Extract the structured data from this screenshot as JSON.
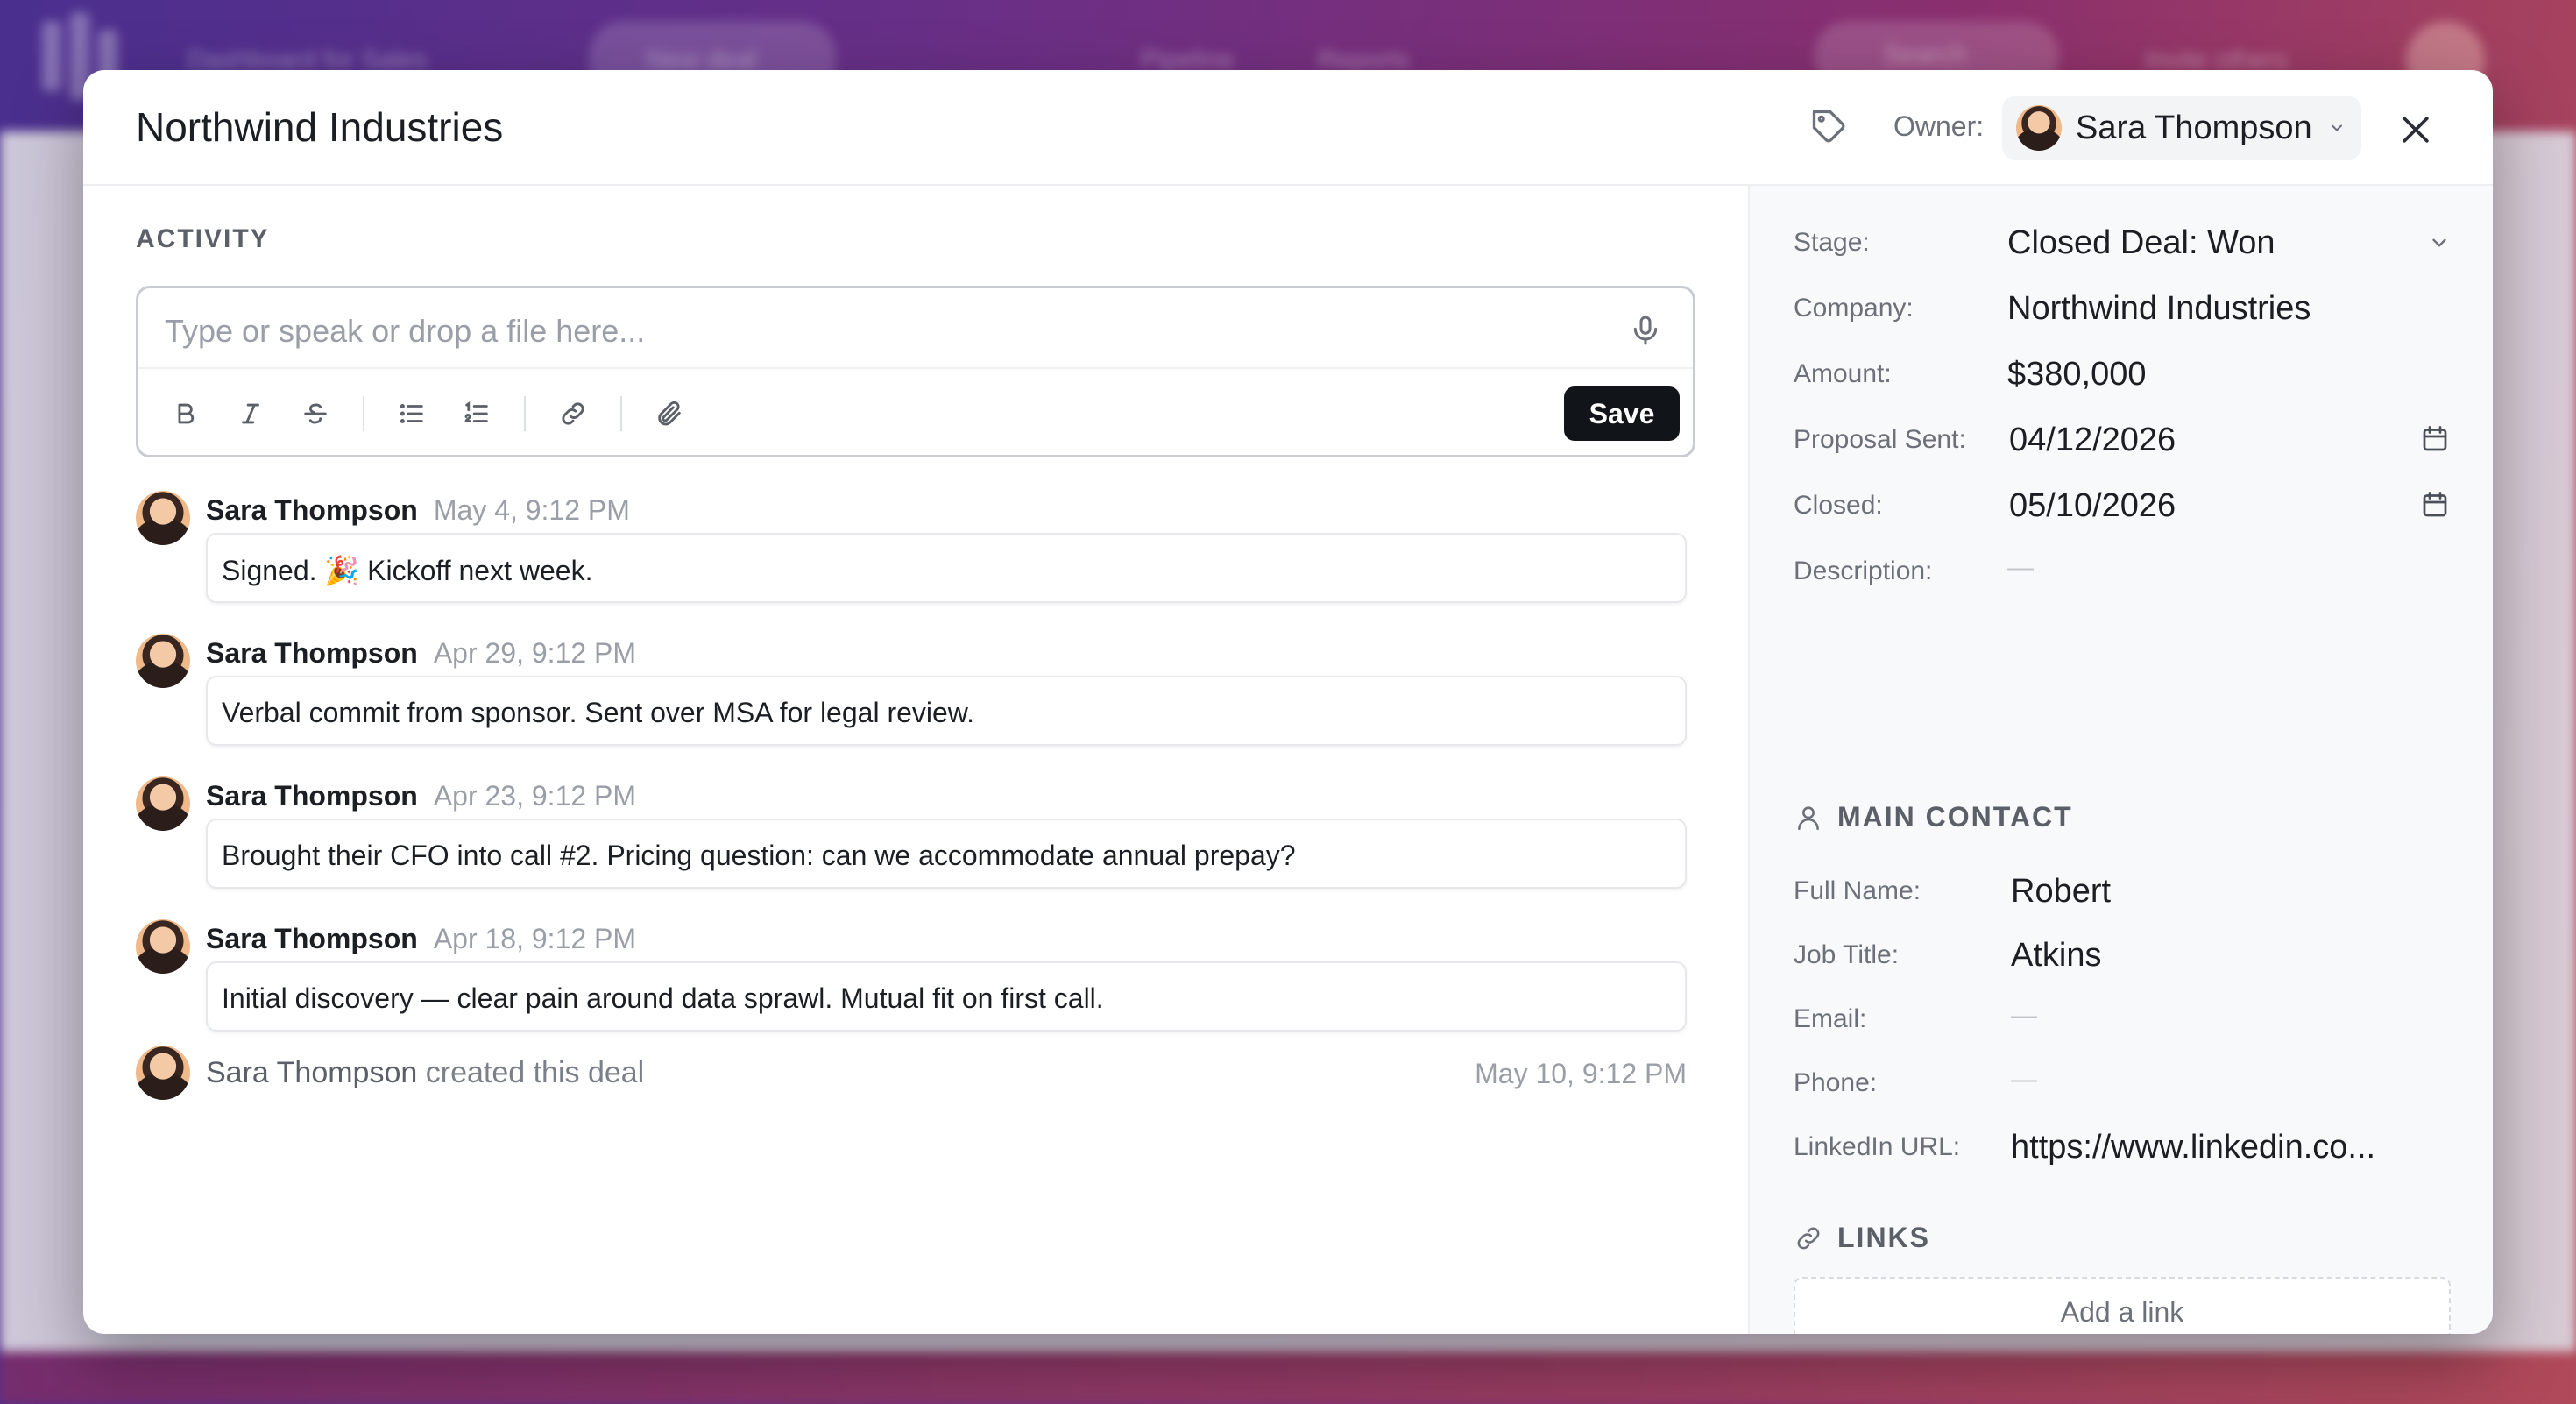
{
  "background": {
    "app_name": "Dashboard for Sales",
    "new_deal_label": "New deal",
    "nav": [
      "Pipeline",
      "Reports"
    ],
    "search_label": "Search",
    "invite_label": "Invite others"
  },
  "modal": {
    "title": "Northwind Industries",
    "owner_label": "Owner:",
    "owner_name": "Sara Thompson",
    "activity_heading": "ACTIVITY",
    "composer_placeholder": "Type or speak or drop a file here...",
    "save_label": "Save",
    "activities": [
      {
        "author": "Sara Thompson",
        "time": "May 4, 9:12 PM",
        "text": "Signed. 🎉 Kickoff next week."
      },
      {
        "author": "Sara Thompson",
        "time": "Apr 29, 9:12 PM",
        "text": "Verbal commit from sponsor. Sent over MSA for legal review."
      },
      {
        "author": "Sara Thompson",
        "time": "Apr 23, 9:12 PM",
        "text": "Brought their CFO into call #2. Pricing question: can we accommodate annual prepay?"
      },
      {
        "author": "Sara Thompson",
        "time": "Apr 18, 9:12 PM",
        "text": "Initial discovery — clear pain around data sprawl. Mutual fit on first call."
      }
    ],
    "created": {
      "author": "Sara Thompson",
      "suffix": " created this deal",
      "time": "May 10, 9:12 PM"
    }
  },
  "details": {
    "stage_label": "Stage:",
    "stage_value": "Closed Deal: Won",
    "company_label": "Company:",
    "company_value": "Northwind Industries",
    "amount_label": "Amount:",
    "amount_value": "$380,000",
    "proposal_label": "Proposal Sent:",
    "proposal_value": "04/12/2026",
    "closed_label": "Closed:",
    "closed_value": "05/10/2026",
    "description_label": "Description:",
    "description_value": "—"
  },
  "contact": {
    "heading": "MAIN CONTACT",
    "full_name_label": "Full Name:",
    "full_name_value": "Robert",
    "job_title_label": "Job Title:",
    "job_title_value": "Atkins",
    "email_label": "Email:",
    "email_value": "—",
    "phone_label": "Phone:",
    "phone_value": "—",
    "linkedin_label": "LinkedIn URL:",
    "linkedin_value": "https://www.linkedin.co..."
  },
  "links": {
    "heading": "LINKS",
    "add_label": "Add a link"
  },
  "colors": {
    "accent_dark": "#111418",
    "bg_gradient_start": "#4a2f8f",
    "bg_gradient_end": "#b24a58"
  }
}
